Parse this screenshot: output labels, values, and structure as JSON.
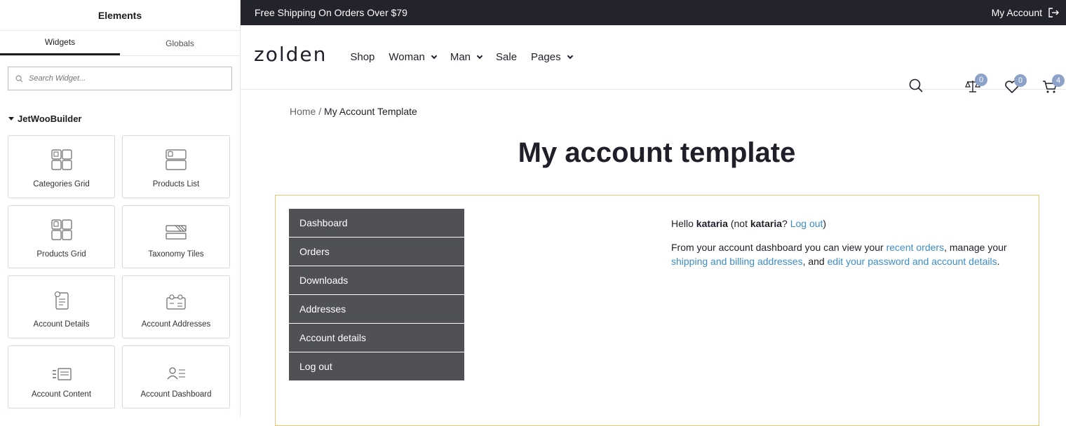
{
  "panel": {
    "title": "Elements",
    "tabs": [
      "Widgets",
      "Globals"
    ],
    "search_placeholder": "Search Widget...",
    "category": "JetWooBuilder",
    "widgets": [
      "Categories Grid",
      "Products List",
      "Products Grid",
      "Taxonomy Tiles",
      "Account Details",
      "Account Addresses",
      "Account Content",
      "Account Dashboard"
    ]
  },
  "site": {
    "topbar": {
      "promo": "Free Shipping On Orders Over $79",
      "account": "My Account"
    },
    "logo": "zolden",
    "menu": [
      "Shop",
      "Woman",
      "Man",
      "Sale",
      "Pages"
    ],
    "badges": {
      "compare": "0",
      "wishlist": "0",
      "cart": "4"
    },
    "breadcrumb": {
      "home": "Home",
      "sep": "/",
      "current": "My Account Template"
    },
    "title": "My account template",
    "account_nav": [
      "Dashboard",
      "Orders",
      "Downloads",
      "Addresses",
      "Account details",
      "Log out"
    ],
    "content": {
      "hello": "Hello ",
      "user": "kataria",
      "not": " (not ",
      "user2": "kataria",
      "q": "? ",
      "logout": "Log out",
      "close": ")",
      "p2a": "From your account dashboard you can view your ",
      "recent_orders": "recent orders",
      "p2b": ", manage your ",
      "addresses": "shipping and billing addresses",
      "p2c": ", and ",
      "edit": "edit your password and account details",
      "p2d": "."
    }
  }
}
